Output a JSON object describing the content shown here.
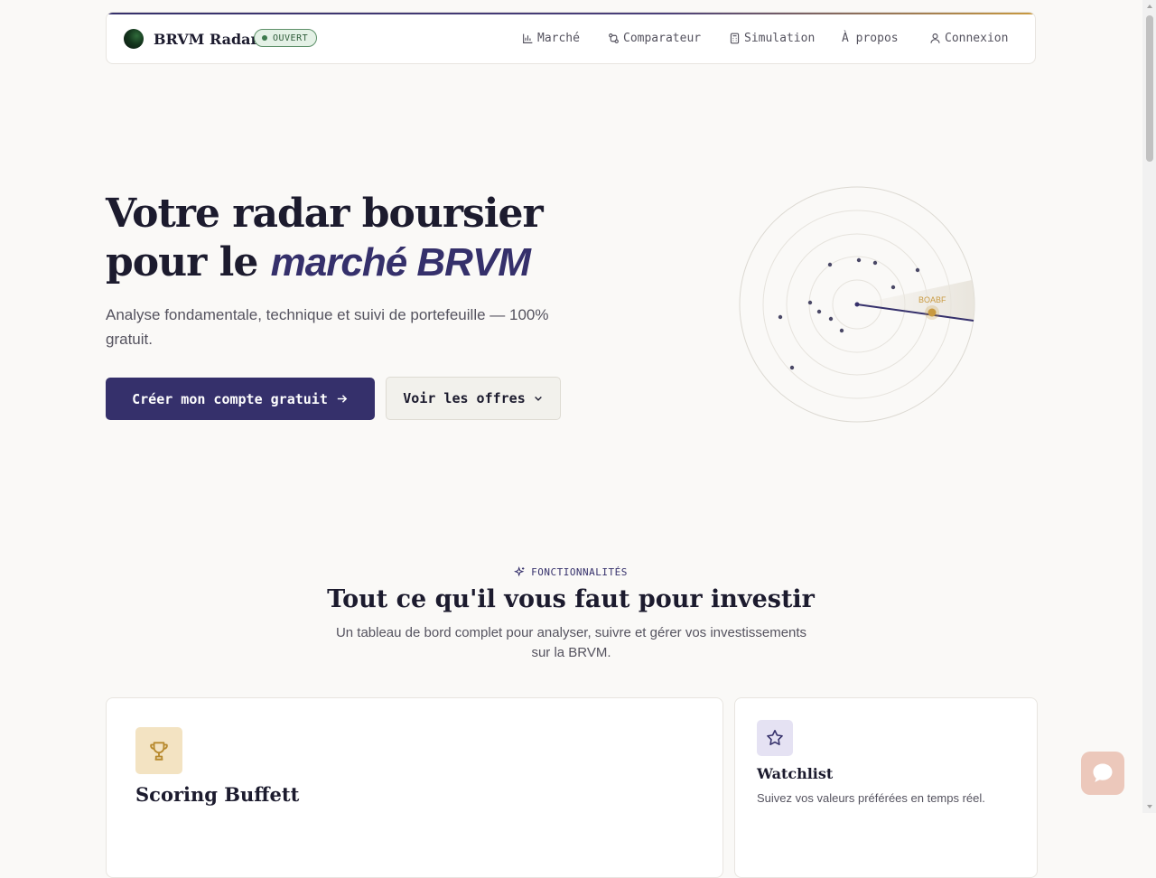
{
  "nav": {
    "brand": "BRVM Radar",
    "status_badge": "OUVERT",
    "items": [
      {
        "label": "Marché",
        "icon": "bar-chart-icon"
      },
      {
        "label": "Comparateur",
        "icon": "compare-icon"
      },
      {
        "label": "Simulation",
        "icon": "calculator-icon"
      },
      {
        "label": "À propos",
        "icon": null
      },
      {
        "label": "Connexion",
        "icon": "user-icon"
      }
    ]
  },
  "hero": {
    "title_line1": "Votre radar boursier",
    "title_line2_plain": "pour le ",
    "title_line2_accent": "marché BRVM",
    "subtitle": "Analyse fondamentale, technique et suivi de portefeuille — 100% gratuit.",
    "cta_primary": "Créer mon compte gratuit",
    "cta_secondary": "Voir les offres",
    "radar_label": "BOABF"
  },
  "features": {
    "tag": "FONCTIONNALITÉS",
    "title": "Tout ce qu'il vous faut pour investir",
    "subtitle": "Un tableau de bord complet pour analyser, suivre et gérer vos investissements sur la BRVM.",
    "cards": [
      {
        "title": "Scoring Buffett",
        "icon": "trophy-icon",
        "text": ""
      },
      {
        "title": "Watchlist",
        "icon": "star-icon",
        "text": "Suivez vos valeurs préférées en temps réel."
      }
    ]
  },
  "colors": {
    "primary": "#35306b",
    "accent_gold": "#c99a40",
    "status_green": "#3d7a4d",
    "background": "#faf9f7"
  }
}
